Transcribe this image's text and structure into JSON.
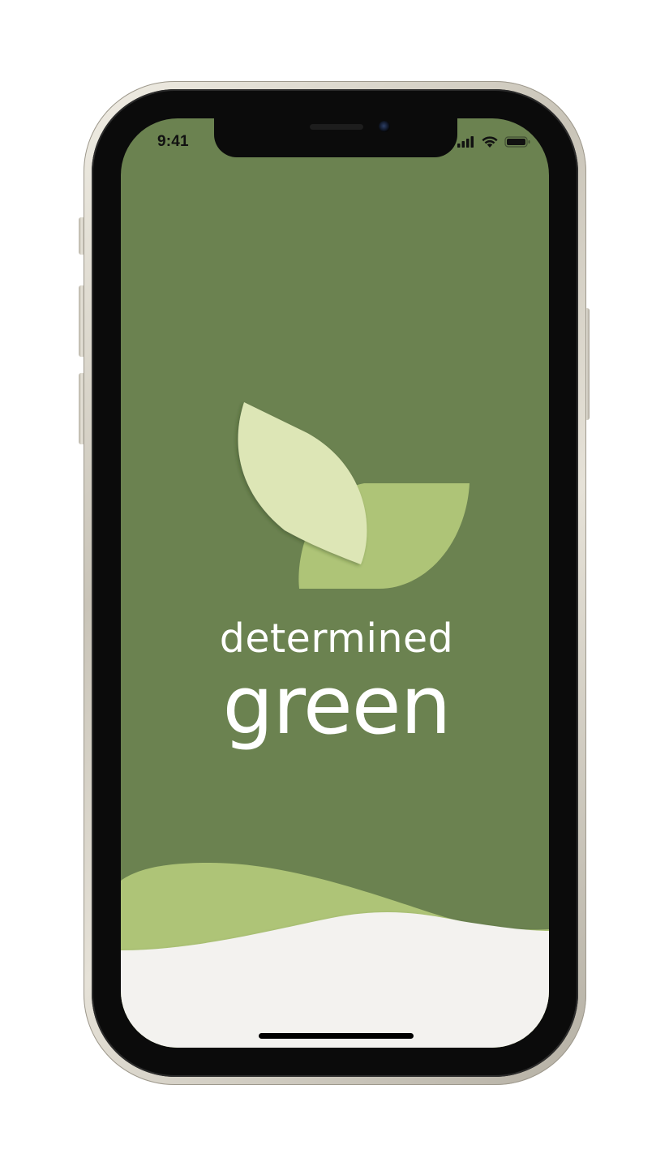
{
  "status_bar": {
    "time": "9:41",
    "icons": [
      "signal-icon",
      "wifi-icon",
      "battery-icon"
    ]
  },
  "brand": {
    "line1": "determined",
    "line2": "green"
  },
  "colors": {
    "background_green": "#6b8250",
    "leaf_light": "#dde6b6",
    "leaf_mid": "#aec477",
    "bottom_panel": "#f3f2ef",
    "text": "#ffffff"
  }
}
